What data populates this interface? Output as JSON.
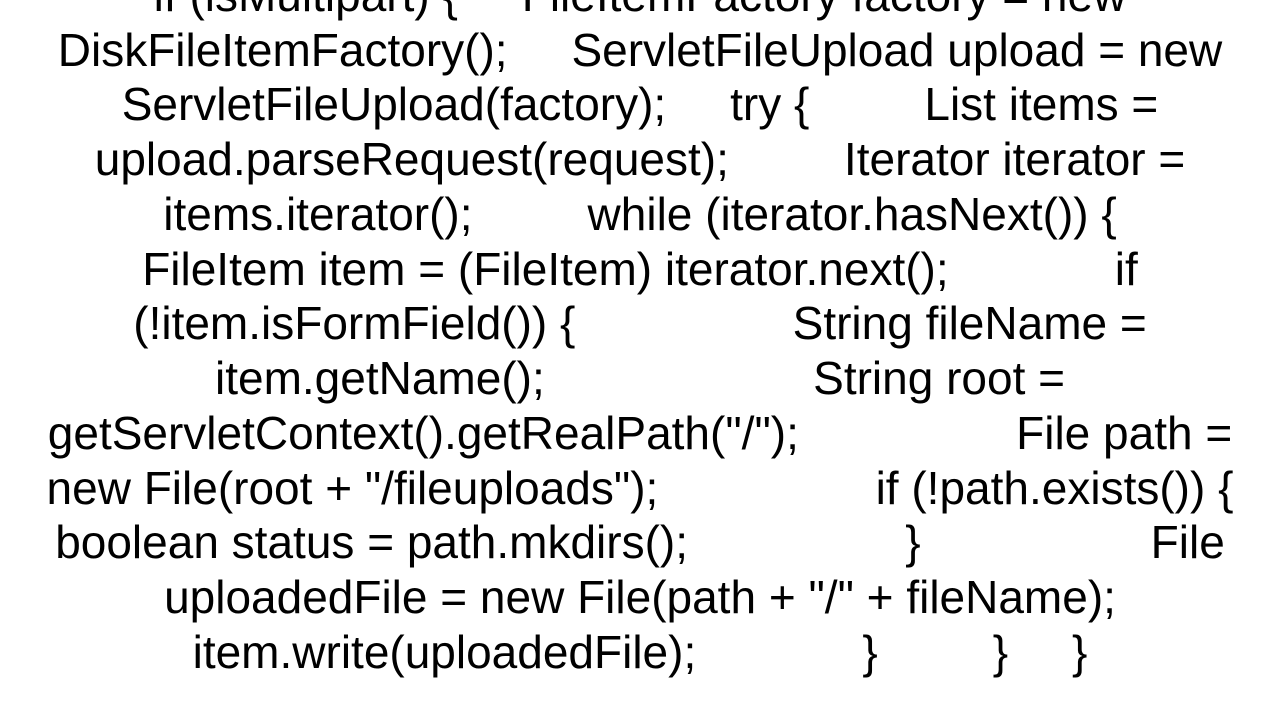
{
  "code_text": "if (isMultipart) {     FileItemFactory factory = new DiskFileItemFactory();     ServletFileUpload upload = new ServletFileUpload(factory);     try {         List items = upload.parseRequest(request);         Iterator iterator = items.iterator();         while (iterator.hasNext()) {             FileItem item = (FileItem) iterator.next();             if (!item.isFormField()) {                 String fileName = item.getName();                     String root = getServletContext().getRealPath(\"/\");                 File path = new File(root + \"/fileuploads\");                 if (!path.exists()) {                     boolean status = path.mkdirs();                 }                  File uploadedFile = new File(path + \"/\" + fileName);                 item.write(uploadedFile);             }         }     }"
}
